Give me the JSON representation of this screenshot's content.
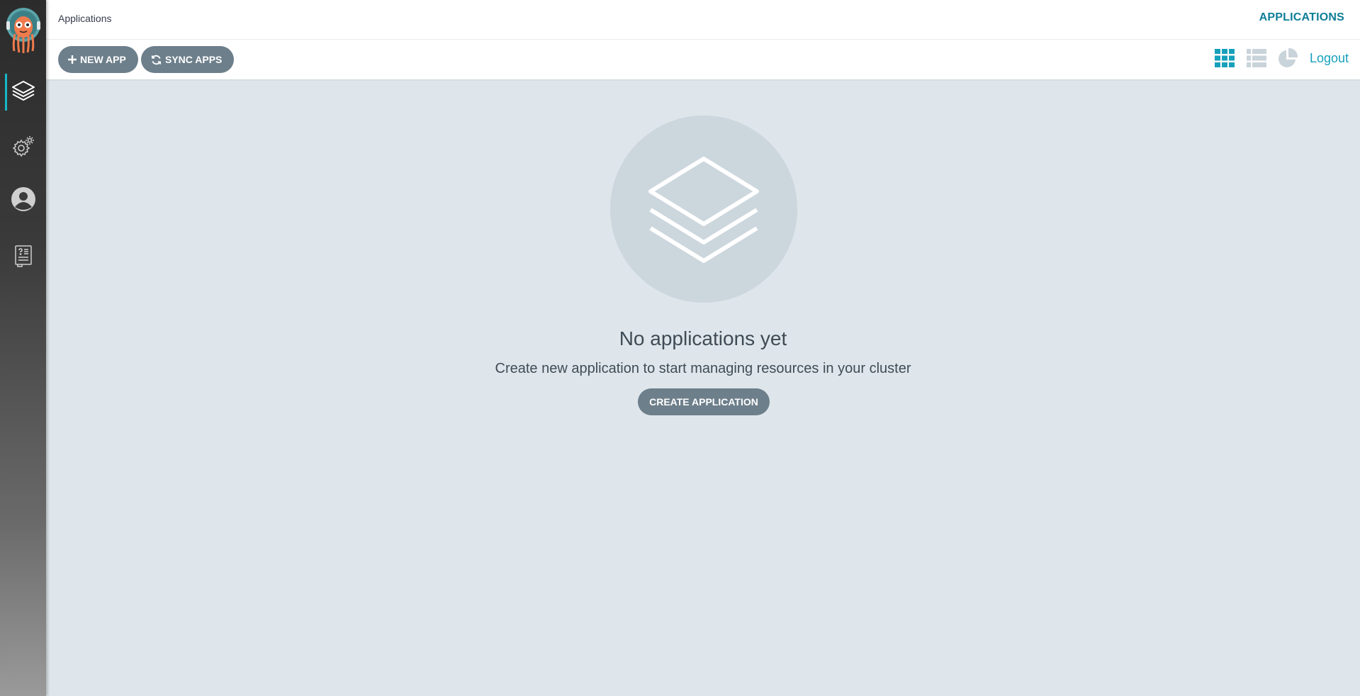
{
  "header": {
    "page_title": "Applications",
    "section_title": "APPLICATIONS"
  },
  "sidebar": {
    "items": [
      {
        "icon": "layers-icon",
        "active": true
      },
      {
        "icon": "gear-icon",
        "active": false
      },
      {
        "icon": "user-icon",
        "active": false
      },
      {
        "icon": "docs-icon",
        "active": false
      }
    ]
  },
  "toolbar": {
    "new_app_label": "NEW APP",
    "sync_apps_label": "SYNC APPS",
    "logout_label": "Logout",
    "views": [
      "tiles-view-icon",
      "list-view-icon",
      "summary-pie-icon"
    ]
  },
  "empty_state": {
    "title": "No applications yet",
    "subtitle": "Create new application to start managing resources in your cluster",
    "create_label": "CREATE APPLICATION"
  },
  "colors": {
    "accent": "#17a0bb",
    "button": "#6d7f8b",
    "background": "#dee6eb"
  }
}
